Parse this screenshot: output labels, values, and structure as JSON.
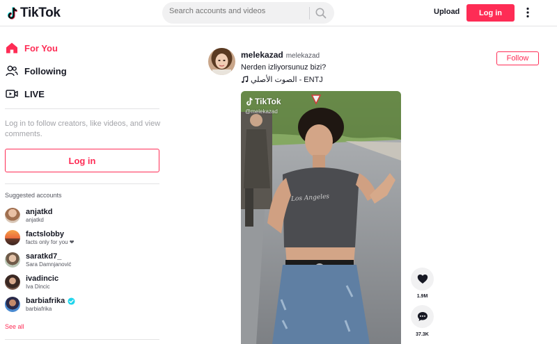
{
  "header": {
    "logo_text": "TikTok",
    "search_placeholder": "Search accounts and videos",
    "upload_label": "Upload",
    "login_label": "Log in"
  },
  "sidebar": {
    "nav": [
      {
        "label": "For You",
        "icon": "home-icon",
        "active": true
      },
      {
        "label": "Following",
        "icon": "following-icon",
        "active": false
      },
      {
        "label": "LIVE",
        "icon": "live-icon",
        "active": false
      }
    ],
    "login_prompt": "Log in to follow creators, like videos, and view comments.",
    "login_label": "Log in",
    "suggested_title": "Suggested accounts",
    "accounts": [
      {
        "name": "anjatkd",
        "sub": "anjatkd",
        "verified": false
      },
      {
        "name": "factslobby",
        "sub": "facts only for you ❤",
        "verified": false
      },
      {
        "name": "saratkd7_",
        "sub": "Sara Damnjanović",
        "verified": false
      },
      {
        "name": "ivadincic",
        "sub": "Iva Dincic",
        "verified": false
      },
      {
        "name": "barbiafrika",
        "sub": "barbiafrika",
        "verified": true
      }
    ],
    "see_all": "See all"
  },
  "post": {
    "author": "melekazad",
    "nickname": "melekazad",
    "caption": "Nerden izliyorsunuz bizi?",
    "music": "الصوت الأصلي - ENTJ",
    "follow_label": "Follow",
    "watermark": "TikTok",
    "watermark_user": "@melekazad",
    "shirt_text": "Los Angeles",
    "likes": "1.9M",
    "comments": "37.3K"
  },
  "colors": {
    "brand": "#fe2c55",
    "text": "#161823",
    "muted": "#a2a3a8"
  }
}
